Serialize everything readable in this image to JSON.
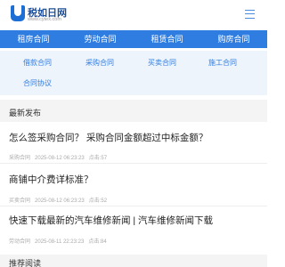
{
  "header": {
    "logo_name": "税如日网",
    "logo_url": "www.cytex.com"
  },
  "nav": {
    "items": [
      "租房合同",
      "劳动合同",
      "租赁合同",
      "购房合同"
    ]
  },
  "sub_nav": {
    "items": [
      "借款合同",
      "采购合同",
      "买卖合同",
      "施工合同",
      "合同协议"
    ]
  },
  "latest": {
    "title": "最新发布",
    "articles": [
      {
        "title": "怎么签采购合同？  采购合同金额超过中标金额？",
        "category": "采购合同",
        "date": "2025-08-12 06:23:23",
        "views": "点击:57"
      },
      {
        "title": "商铺中介费详标准？",
        "category": "买卖合同",
        "date": "2025-08-12 06:23:23",
        "views": "点击:52"
      },
      {
        "title": "快速下载最新的汽车维修新闻 | 汽车维修新闻下载",
        "category": "劳动合同",
        "date": "2025-08-11 22:23:23",
        "views": "点击:84"
      }
    ]
  },
  "recommend": {
    "title": "推荐阅读"
  }
}
